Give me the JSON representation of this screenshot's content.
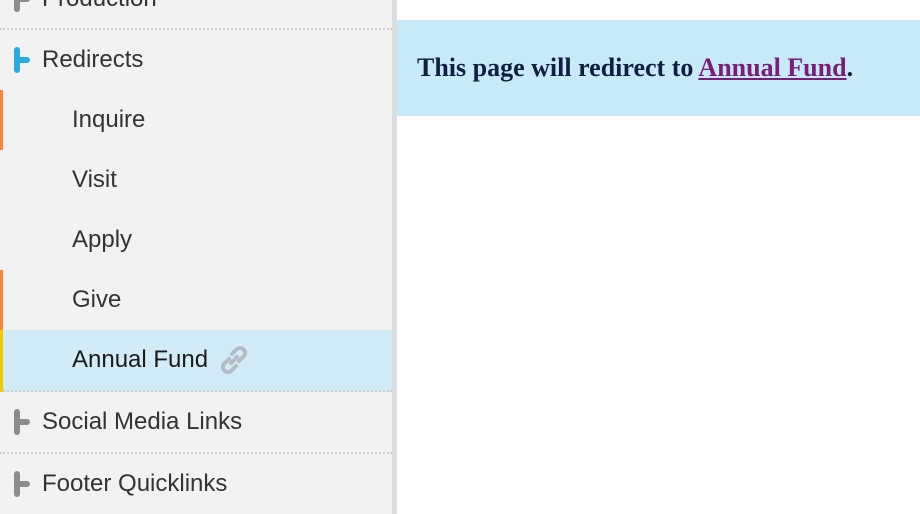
{
  "sidebar": {
    "items": [
      {
        "label": "Production",
        "type": "parent"
      },
      {
        "label": "Redirects",
        "type": "parent",
        "expanded": true
      },
      {
        "label": "Inquire",
        "type": "child"
      },
      {
        "label": "Visit",
        "type": "child"
      },
      {
        "label": "Apply",
        "type": "child"
      },
      {
        "label": "Give",
        "type": "child"
      },
      {
        "label": "Annual Fund",
        "type": "child",
        "selected": true,
        "icon": "link-icon"
      },
      {
        "label": "Social Media Links",
        "type": "parent"
      },
      {
        "label": "Footer Quicklinks",
        "type": "parent"
      }
    ]
  },
  "notice": {
    "prefix": "This page will redirect to ",
    "link_text": "Annual Fund",
    "suffix": "."
  },
  "colors": {
    "sidebar_bg": "#f2f2f2",
    "selected_bg": "#d2ecf7",
    "notice_bg": "#c7eaf9",
    "link": "#7b1c78",
    "accent_orange": "#f5883a",
    "accent_yellow": "#f2c800",
    "branch_blue": "#29abe2",
    "branch_gray": "#8c8c8c"
  }
}
